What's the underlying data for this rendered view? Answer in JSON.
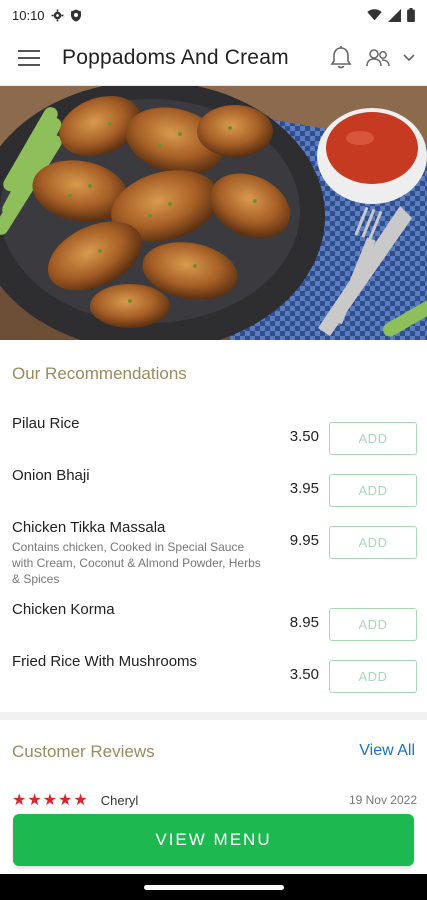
{
  "status_bar": {
    "time": "10:10",
    "icons": [
      "gear-icon",
      "shield-icon",
      "wifi-icon",
      "signal-icon",
      "battery-icon"
    ]
  },
  "header": {
    "title": "Poppadoms And Cream",
    "icons": [
      "menu-icon",
      "bell-icon",
      "users-icon",
      "chevron-down-icon"
    ]
  },
  "hero": {
    "image": "grilled-chicken-wings-photo"
  },
  "recommendations": {
    "title": "Our Recommendations",
    "items": [
      {
        "name": "Pilau Rice",
        "description": "",
        "price": "3.50",
        "button": "ADD"
      },
      {
        "name": "Onion Bhaji",
        "description": "",
        "price": "3.95",
        "button": "ADD"
      },
      {
        "name": "Chicken Tikka Massala",
        "description": "Contains chicken, Cooked in Special Sauce with Cream, Coconut & Almond Powder, Herbs & Spices",
        "price": "9.95",
        "button": "ADD"
      },
      {
        "name": "Chicken Korma",
        "description": "",
        "price": "8.95",
        "button": "ADD"
      },
      {
        "name": "Fried Rice With Mushrooms",
        "description": "",
        "price": "3.50",
        "button": "ADD"
      }
    ]
  },
  "reviews": {
    "title": "Customer Reviews",
    "view_all": "View All",
    "first": {
      "stars": "★★★★★",
      "rating": 5,
      "reviewer": "Cheryl",
      "date": "19 Nov 2022"
    }
  },
  "cta": {
    "label": "VIEW MENU"
  },
  "colors": {
    "accent_green": "#1db84f",
    "add_border": "#a8d8b6",
    "section_title": "#9a8a5e",
    "link_blue": "#1a73c6",
    "star_red": "#e0232e"
  }
}
